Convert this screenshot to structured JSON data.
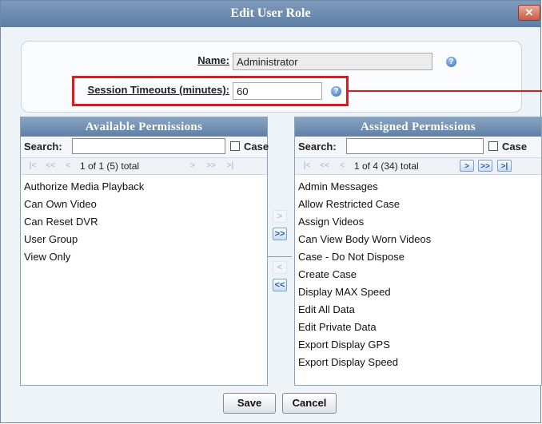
{
  "dialog": {
    "title": "Edit User Role",
    "close_symbol": "✕"
  },
  "form": {
    "name_label": "Name:",
    "name_value": "Administrator",
    "session_label": "Session Timeouts (minutes):",
    "session_value": "60",
    "help_symbol": "?"
  },
  "available": {
    "header": "Available Permissions",
    "search_label": "Search:",
    "search_value": "",
    "case_label": "Case",
    "page_info": "1 of 1 (5) total",
    "items": [
      "Authorize Media Playback",
      "Can Own Video",
      "Can Reset DVR",
      "User Group",
      "View Only"
    ]
  },
  "assigned": {
    "header": "Assigned Permissions",
    "search_label": "Search:",
    "search_value": "",
    "case_label": "Case",
    "page_info": "1 of 4 (34) total",
    "items": [
      "Admin Messages",
      "Allow Restricted Case",
      "Assign Videos",
      "Can View Body Worn Videos",
      "Case - Do Not Dispose",
      "Create Case",
      "Display MAX Speed",
      "Edit All Data",
      "Edit Private Data",
      "Export Display GPS",
      "Export Display Speed"
    ]
  },
  "pager_icons": {
    "first": "|<",
    "prev_page": "<<",
    "prev": "<",
    "next": ">",
    "next_page": ">>",
    "last": ">|"
  },
  "transfer": {
    "add": ">",
    "add_all": ">>",
    "remove": "<",
    "remove_all": "<<"
  },
  "buttons": {
    "save": "Save",
    "cancel": "Cancel"
  },
  "colors": {
    "titlebar": "#5c7ea6",
    "highlight": "#e31818",
    "accent": "#1a5fb4"
  }
}
